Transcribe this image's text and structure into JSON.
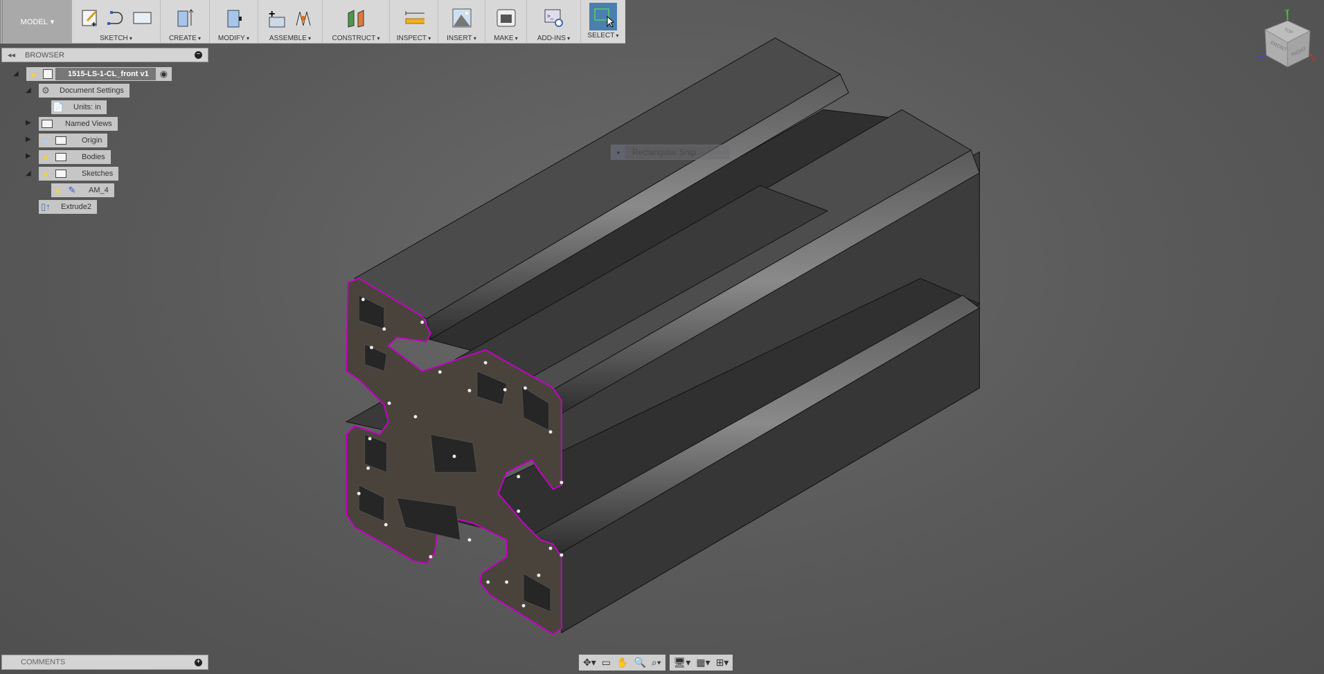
{
  "toolbar": {
    "mode": "MODEL",
    "groups": [
      {
        "label": "SKETCH"
      },
      {
        "label": "CREATE"
      },
      {
        "label": "MODIFY"
      },
      {
        "label": "ASSEMBLE"
      },
      {
        "label": "CONSTRUCT"
      },
      {
        "label": "INSPECT"
      },
      {
        "label": "INSERT"
      },
      {
        "label": "MAKE"
      },
      {
        "label": "ADD-INS"
      },
      {
        "label": "SELECT"
      }
    ]
  },
  "browser": {
    "title": "BROWSER",
    "root": "1515-LS-1-CL_front v1",
    "items": [
      {
        "label": "Document Settings",
        "icon": "gear-icon"
      },
      {
        "label": "Units: in",
        "icon": "document-icon"
      },
      {
        "label": "Named Views",
        "icon": "folder-icon"
      },
      {
        "label": "Origin",
        "icon": "folder-icon"
      },
      {
        "label": "Bodies",
        "icon": "folder-icon"
      },
      {
        "label": "Sketches",
        "icon": "folder-icon"
      },
      {
        "label": "AM_4",
        "icon": "sketch-icon"
      },
      {
        "label": "Extrude2",
        "icon": "extrude-icon"
      }
    ]
  },
  "comments": {
    "title": "COMMENTS"
  },
  "tooltip": {
    "label": "Rectangular Snip"
  },
  "viewcube": {
    "top": "TOP",
    "front": "FRONT",
    "right": "RIGHT",
    "x": "X",
    "y": "Y",
    "z": "Z"
  },
  "colors": {
    "profile_edge": "#c800c8",
    "select_active": "#4a7fb0",
    "panel": "#d4d4d4"
  }
}
